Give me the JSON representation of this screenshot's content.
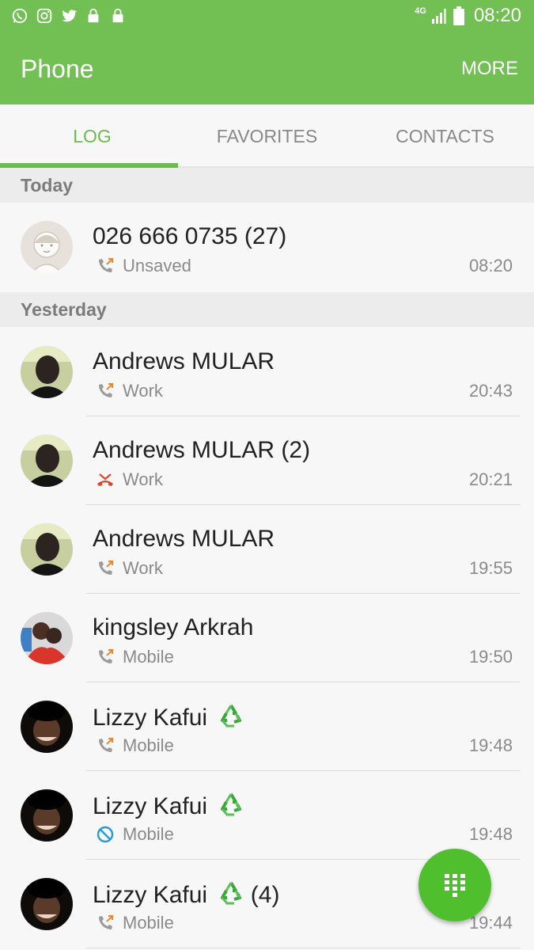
{
  "status_bar": {
    "network": "4G",
    "clock": "08:20",
    "notification_icons": [
      "whatsapp-icon",
      "instagram-icon",
      "twitter-icon",
      "lock-icon",
      "lock-icon"
    ]
  },
  "app_bar": {
    "title": "Phone",
    "more_label": "MORE"
  },
  "tabs": [
    {
      "label": "LOG",
      "active": true
    },
    {
      "label": "FAVORITES",
      "active": false
    },
    {
      "label": "CONTACTS",
      "active": false
    }
  ],
  "sections": {
    "today": "Today",
    "yesterday": "Yesterday"
  },
  "log": [
    {
      "name": "026 666 0735",
      "count": "(27)",
      "type": "Unsaved",
      "time": "08:20",
      "icon": "outgoing-call-icon",
      "recycle": false
    },
    {
      "name": "Andrews MULAR",
      "count": "",
      "type": "Work",
      "time": "20:43",
      "icon": "outgoing-call-icon",
      "recycle": false
    },
    {
      "name": "Andrews MULAR",
      "count": "(2)",
      "type": "Work",
      "time": "20:21",
      "icon": "missed-call-icon",
      "recycle": false
    },
    {
      "name": "Andrews MULAR",
      "count": "",
      "type": "Work",
      "time": "19:55",
      "icon": "outgoing-call-icon",
      "recycle": false
    },
    {
      "name": "kingsley Arkrah",
      "count": "",
      "type": "Mobile",
      "time": "19:50",
      "icon": "outgoing-call-icon",
      "recycle": false
    },
    {
      "name": "Lizzy Kafui",
      "count": "",
      "type": "Mobile",
      "time": "19:48",
      "icon": "outgoing-call-icon",
      "recycle": true
    },
    {
      "name": "Lizzy Kafui",
      "count": "",
      "type": "Mobile",
      "time": "19:48",
      "icon": "blocked-call-icon",
      "recycle": true
    },
    {
      "name": "Lizzy Kafui",
      "count": "(4)",
      "type": "Mobile",
      "time": "19:44",
      "icon": "outgoing-call-icon",
      "recycle": true
    }
  ],
  "colors": {
    "accent": "#72bf54",
    "fab": "#4fbf2d",
    "missed": "#e0452b",
    "outgoing_arrow": "#f08a2c",
    "blocked": "#2a9ad6"
  }
}
